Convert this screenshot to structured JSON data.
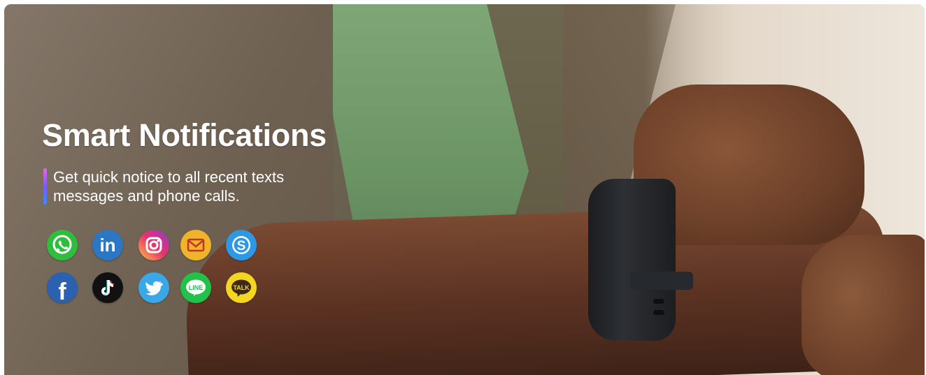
{
  "hero": {
    "title": "Smart Notifications",
    "description": "Get quick notice to all recent texts messages and phone calls."
  },
  "app_icons": [
    {
      "name": "whatsapp-icon",
      "color": "#2fbd3e",
      "glyph": ""
    },
    {
      "name": "linkedin-icon",
      "color": "#2c77c4",
      "glyph": "in"
    },
    {
      "name": "instagram-icon",
      "color": "#dc3e7a",
      "glyph": ""
    },
    {
      "name": "email-icon",
      "color": "#f0b42a",
      "glyph": ""
    },
    {
      "name": "skype-icon",
      "color": "#2d98e5",
      "glyph": "S"
    },
    {
      "name": "facebook-icon",
      "color": "#2b61b0",
      "glyph": "f"
    },
    {
      "name": "tiktok-icon",
      "color": "#111111",
      "glyph": ""
    },
    {
      "name": "twitter-icon",
      "color": "#3aa7e6",
      "glyph": ""
    },
    {
      "name": "line-icon",
      "color": "#22c24a",
      "glyph": "LINE"
    },
    {
      "name": "kakaotalk-icon",
      "color": "#f4d51f",
      "glyph": "TALK"
    }
  ]
}
